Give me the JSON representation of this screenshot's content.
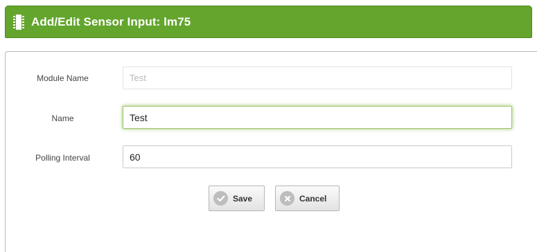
{
  "header": {
    "title": "Add/Edit Sensor Input: lm75",
    "icon": "chip-icon",
    "color": "#63a52d"
  },
  "form": {
    "module_name": {
      "label": "Module Name",
      "value": "Test"
    },
    "name": {
      "label": "Name",
      "value": "Test"
    },
    "polling_interval": {
      "label": "Polling Interval",
      "value": "60"
    }
  },
  "buttons": {
    "save_label": "Save",
    "cancel_label": "Cancel",
    "save_icon": "check-icon",
    "cancel_icon": "close-icon"
  }
}
